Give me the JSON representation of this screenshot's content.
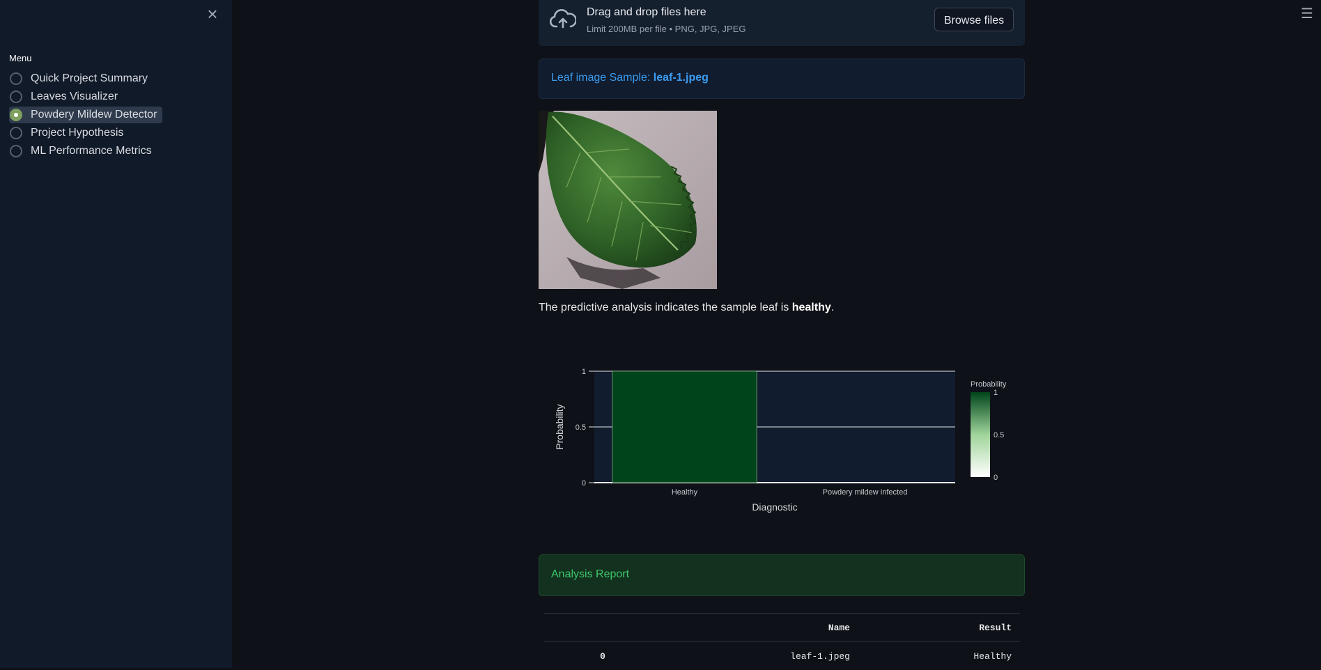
{
  "sidebar": {
    "close_glyph": "×",
    "menu_label": "Menu",
    "items": [
      {
        "label": "Quick Project Summary",
        "selected": false
      },
      {
        "label": "Leaves Visualizer",
        "selected": false
      },
      {
        "label": "Powdery Mildew Detector",
        "selected": true
      },
      {
        "label": "Project Hypothesis",
        "selected": false
      },
      {
        "label": "ML Performance Metrics",
        "selected": false
      }
    ]
  },
  "header": {
    "menu_glyph": "☰"
  },
  "uploader": {
    "title": "Drag and drop files here",
    "subtitle": "Limit 200MB per file • PNG, JPG, JPEG",
    "browse_label": "Browse files",
    "icon": "cloud-upload-icon"
  },
  "sample": {
    "prefix": "Leaf image Sample: ",
    "filename": "leaf-1.jpeg"
  },
  "prediction": {
    "prefix": "The predictive analysis indicates the sample leaf is ",
    "result": "healthy",
    "suffix": "."
  },
  "chart_data": {
    "type": "bar",
    "categories": [
      "Healthy",
      "Powdery mildew infected"
    ],
    "values": [
      1,
      0
    ],
    "xlabel": "Diagnostic",
    "ylabel": "Probability",
    "ylim": [
      0,
      1
    ],
    "yticks": [
      "0",
      "0.5",
      "1"
    ],
    "colorbar": {
      "title": "Probability",
      "ticks": [
        "0",
        "0.5",
        "1"
      ],
      "low": "#ffffff",
      "high": "#00441b"
    },
    "bar_color": "#00441b",
    "grid": true
  },
  "report": {
    "title": "Analysis Report",
    "columns": [
      "",
      "Name",
      "Result"
    ],
    "rows": [
      {
        "index": "0",
        "name": "leaf-1.jpeg",
        "result": "Healthy"
      }
    ]
  },
  "colors": {
    "background": "#0e1117",
    "sidebar": "#111a29",
    "info": "#3b9cf0",
    "success": "#3ec76a"
  }
}
